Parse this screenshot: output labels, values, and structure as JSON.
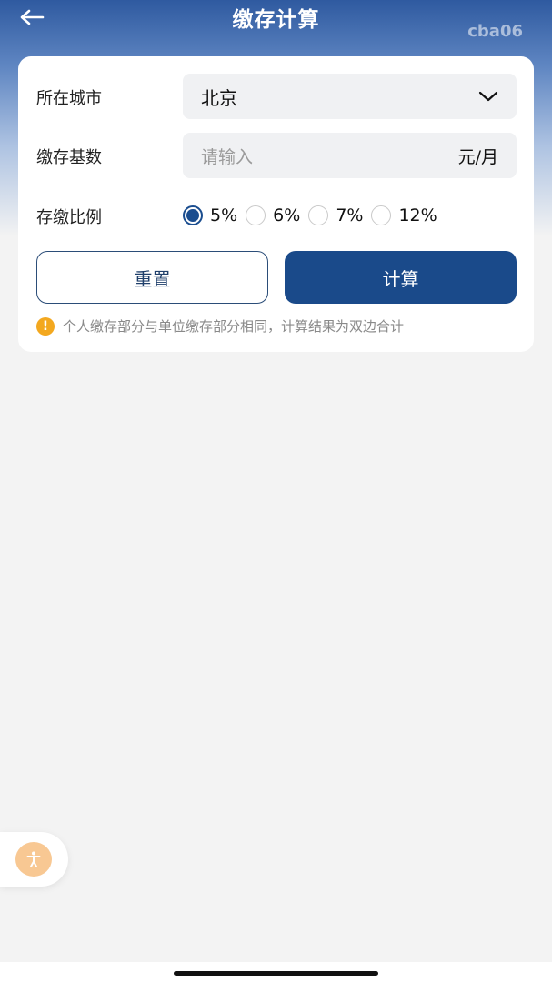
{
  "header": {
    "title": "缴存计算",
    "watermark": "cba06"
  },
  "form": {
    "city": {
      "label": "所在城市",
      "value": "北京"
    },
    "base": {
      "label": "缴存基数",
      "placeholder": "请输入",
      "unit": "元/月"
    },
    "ratio": {
      "label": "存缴比例",
      "options": [
        "5%",
        "6%",
        "7%",
        "12%"
      ],
      "selected": "5%"
    }
  },
  "buttons": {
    "reset": "重置",
    "calculate": "计算"
  },
  "tip": {
    "icon": "!",
    "text": "个人缴存部分与单位缴存部分相同，计算结果为双边合计"
  },
  "colors": {
    "primary": "#1a4a8a",
    "warning": "#f3a81f",
    "accessibility": "#f8c893"
  }
}
